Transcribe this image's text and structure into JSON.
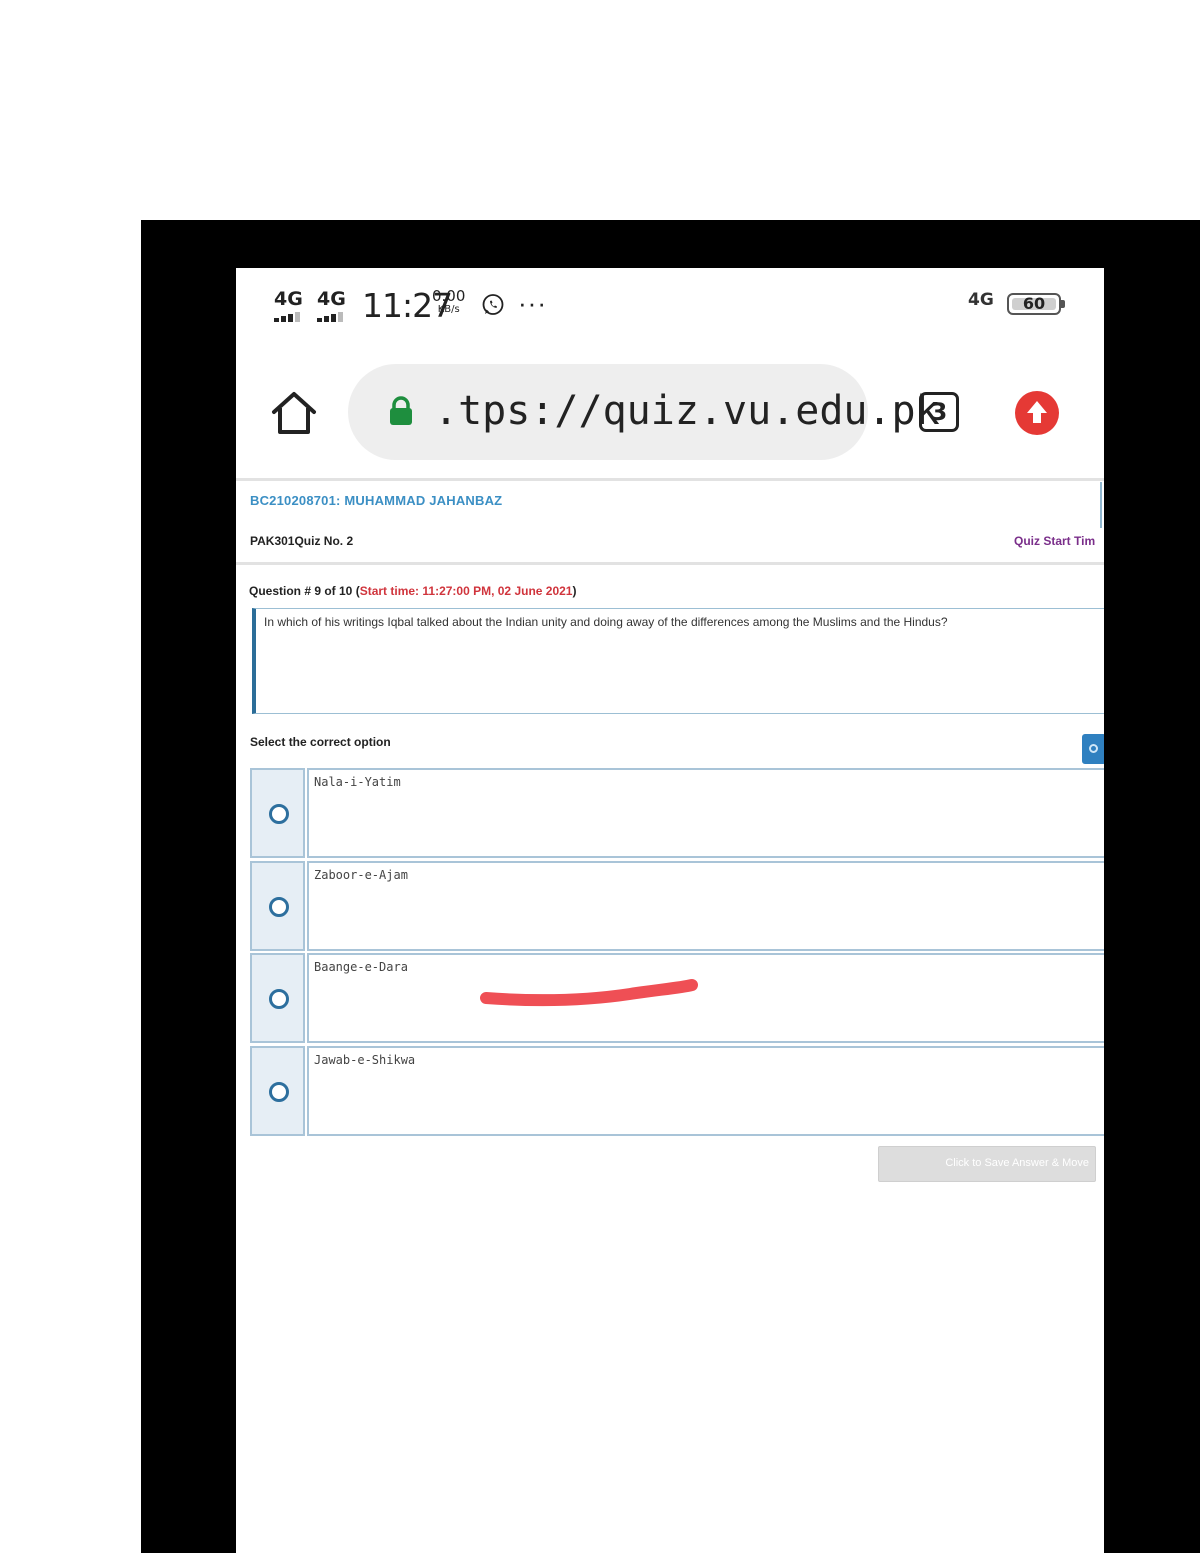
{
  "status_bar": {
    "signal1": "4G",
    "signal2": "4G",
    "time": "11:27",
    "data_rate_value": "0.00",
    "data_rate_unit": "KB/s",
    "more": "···",
    "network": "4G",
    "battery": "60"
  },
  "browser": {
    "url": ".tps://quiz.vu.edu.pk",
    "tab_count": "3"
  },
  "header": {
    "student": "BC210208701: MUHAMMAD JAHANBAZ",
    "quiz_title": "PAK301Quiz No. 2",
    "quiz_start": "Quiz Start Tim"
  },
  "question": {
    "label": "Question # 9 of 10 (",
    "start_time": "Start time: 11:27:00 PM, 02 June 2021",
    "close": ")",
    "text": "In which of his writings Iqbal talked about the Indian unity and doing away of the differences among the Muslims and the Hindus?"
  },
  "select_label": "Select the correct option",
  "options": [
    {
      "label": "Nala-i-Yatim"
    },
    {
      "label": "Zaboor-e-Ajam"
    },
    {
      "label": "Baange-e-Dara"
    },
    {
      "label": "Jawab-e-Shikwa"
    }
  ],
  "save_button": "Click to Save Answer & Move",
  "colors": {
    "student": "#3b8fc4",
    "start_time": "#d0343c",
    "quiz_start": "#7a2e8a",
    "upload": "#e53935",
    "lock": "#1e8e3e",
    "mark": "#ef4f55"
  }
}
